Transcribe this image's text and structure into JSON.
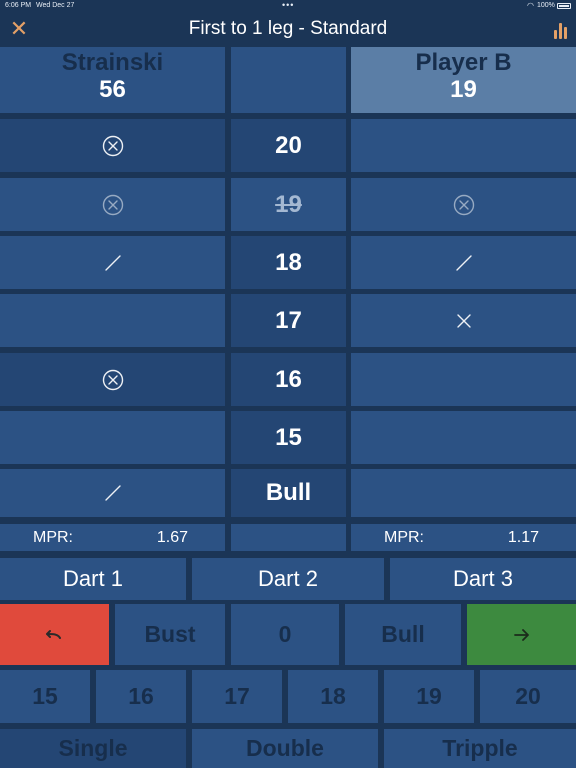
{
  "status_bar": {
    "time": "6:06 PM",
    "date": "Wed Dec 27",
    "battery_pct": "100%"
  },
  "nav": {
    "title": "First to 1 leg - Standard",
    "close_icon": "close-icon",
    "stats_icon": "bar-chart-icon"
  },
  "players": [
    {
      "name": "Strainski",
      "score": "56",
      "active": false
    },
    {
      "name": "Player B",
      "score": "19",
      "active": true
    }
  ],
  "rows": [
    {
      "number": "20",
      "closed": false,
      "left_mark": "circled-x",
      "right_mark": ""
    },
    {
      "number": "19",
      "closed": true,
      "left_mark": "circled-x",
      "right_mark": "circled-x"
    },
    {
      "number": "18",
      "closed": false,
      "left_mark": "slash",
      "right_mark": "slash"
    },
    {
      "number": "17",
      "closed": false,
      "left_mark": "",
      "right_mark": "x"
    },
    {
      "number": "16",
      "closed": false,
      "left_mark": "circled-x",
      "right_mark": ""
    },
    {
      "number": "15",
      "closed": false,
      "left_mark": "",
      "right_mark": ""
    },
    {
      "number": "Bull",
      "closed": false,
      "left_mark": "slash",
      "right_mark": ""
    }
  ],
  "mpr": {
    "label": "MPR:",
    "left": "1.67",
    "right": "1.17"
  },
  "darts": [
    "Dart 1",
    "Dart 2",
    "Dart 3"
  ],
  "action_row": {
    "undo_icon": "undo-icon",
    "bust": "Bust",
    "zero": "0",
    "bull": "Bull",
    "next_icon": "arrow-right-icon"
  },
  "number_buttons": [
    "15",
    "16",
    "17",
    "18",
    "19",
    "20"
  ],
  "multipliers": [
    "Single",
    "Double",
    "Tripple"
  ],
  "colors": {
    "background": "#1b3556",
    "cell": "#2c5284",
    "cell_dark": "#244674",
    "active_player": "#5b7ea6",
    "undo": "#e04a3c",
    "next": "#3d8a3f",
    "accent": "#e3a067"
  }
}
